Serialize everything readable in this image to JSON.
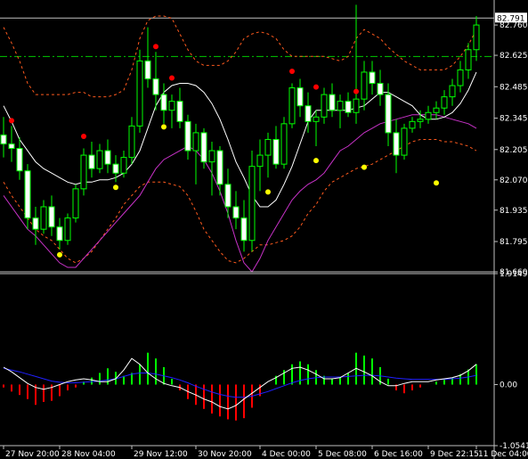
{
  "chart_data": [
    {
      "type": "candlestick",
      "panel": "price",
      "ylim": [
        81.66,
        82.8
      ],
      "y_ticks": [
        "82.760",
        "82.625",
        "82.485",
        "82.345",
        "82.205",
        "82.070",
        "81.935",
        "81.795",
        "81.660"
      ],
      "y_tick_values": [
        82.76,
        82.625,
        82.485,
        82.345,
        82.205,
        82.07,
        81.935,
        81.795,
        81.66
      ],
      "current_price_label": "82.791",
      "current_price": 82.791,
      "dashdot_level": 82.62,
      "colors": {
        "background": "#000000",
        "candle_up_body": "#000000",
        "candle_down_body": "#ffffff",
        "candle_outline": "#00ff00",
        "middle_band": "#ffffff",
        "outer_bands": "#ff5a1e",
        "slow_ma": "#c832c8",
        "dot_high": "#ff0000",
        "dot_low": "#ffff00",
        "dashdot_line": "#00c800",
        "axis": "#c0c0c0"
      },
      "candles_ohlc": [
        [
          82.27,
          82.35,
          82.17,
          82.23
        ],
        [
          82.23,
          82.31,
          82.15,
          82.21
        ],
        [
          82.21,
          82.26,
          82.07,
          82.11
        ],
        [
          82.11,
          82.14,
          81.85,
          81.9
        ],
        [
          81.9,
          81.95,
          81.78,
          81.85
        ],
        [
          81.85,
          81.98,
          81.83,
          81.95
        ],
        [
          81.95,
          82.0,
          81.82,
          81.86
        ],
        [
          81.86,
          81.9,
          81.76,
          81.8
        ],
        [
          81.8,
          81.92,
          81.78,
          81.9
        ],
        [
          81.9,
          82.05,
          81.88,
          82.03
        ],
        [
          82.03,
          82.21,
          82.0,
          82.18
        ],
        [
          82.18,
          82.24,
          82.08,
          82.12
        ],
        [
          82.12,
          82.23,
          82.1,
          82.2
        ],
        [
          82.2,
          82.25,
          82.1,
          82.14
        ],
        [
          82.14,
          82.18,
          82.06,
          82.1
        ],
        [
          82.1,
          82.2,
          82.08,
          82.17
        ],
        [
          82.17,
          82.35,
          82.14,
          82.31
        ],
        [
          82.31,
          82.65,
          82.28,
          82.6
        ],
        [
          82.6,
          82.75,
          82.48,
          82.52
        ],
        [
          82.52,
          82.64,
          82.38,
          82.45
        ],
        [
          82.45,
          82.5,
          82.32,
          82.38
        ],
        [
          82.38,
          82.45,
          82.3,
          82.42
        ],
        [
          82.42,
          82.48,
          82.3,
          82.33
        ],
        [
          82.33,
          82.36,
          82.16,
          82.2
        ],
        [
          82.2,
          82.32,
          82.05,
          82.28
        ],
        [
          82.28,
          82.3,
          82.12,
          82.15
        ],
        [
          82.15,
          82.24,
          82.0,
          82.2
        ],
        [
          82.2,
          82.22,
          82.0,
          82.05
        ],
        [
          82.05,
          82.12,
          81.9,
          81.95
        ],
        [
          81.95,
          82.02,
          81.85,
          81.9
        ],
        [
          81.9,
          81.98,
          81.75,
          81.8
        ],
        [
          81.8,
          82.2,
          81.75,
          82.13
        ],
        [
          82.13,
          82.25,
          82.02,
          82.18
        ],
        [
          82.18,
          82.28,
          82.08,
          82.25
        ],
        [
          82.25,
          82.31,
          82.12,
          82.14
        ],
        [
          82.14,
          82.35,
          82.12,
          82.32
        ],
        [
          82.32,
          82.5,
          82.3,
          82.48
        ],
        [
          82.48,
          82.52,
          82.35,
          82.4
        ],
        [
          82.4,
          82.46,
          82.28,
          82.33
        ],
        [
          82.33,
          82.38,
          82.22,
          82.35
        ],
        [
          82.35,
          82.48,
          82.32,
          82.45
        ],
        [
          82.45,
          82.5,
          82.35,
          82.38
        ],
        [
          82.38,
          82.45,
          82.3,
          82.42
        ],
        [
          82.42,
          82.46,
          82.35,
          82.37
        ],
        [
          82.37,
          82.85,
          82.32,
          82.43
        ],
        [
          82.43,
          82.6,
          82.38,
          82.55
        ],
        [
          82.55,
          82.6,
          82.45,
          82.5
        ],
        [
          82.5,
          82.56,
          82.4,
          82.45
        ],
        [
          82.45,
          82.5,
          82.22,
          82.28
        ],
        [
          82.28,
          82.34,
          82.1,
          82.18
        ],
        [
          82.18,
          82.32,
          82.16,
          82.3
        ],
        [
          82.3,
          82.35,
          82.28,
          82.33
        ],
        [
          82.33,
          82.38,
          82.3,
          82.34
        ],
        [
          82.34,
          82.4,
          82.32,
          82.37
        ],
        [
          82.37,
          82.42,
          82.34,
          82.39
        ],
        [
          82.39,
          82.47,
          82.36,
          82.44
        ],
        [
          82.44,
          82.52,
          82.4,
          82.49
        ],
        [
          82.49,
          82.6,
          82.46,
          82.56
        ],
        [
          82.56,
          82.68,
          82.52,
          82.65
        ],
        [
          82.65,
          82.8,
          82.6,
          82.76
        ]
      ],
      "high_dots": [
        [
          1,
          82.31
        ],
        [
          10,
          82.24
        ],
        [
          19,
          82.64
        ],
        [
          21,
          82.5
        ],
        [
          36,
          82.53
        ],
        [
          39,
          82.46
        ],
        [
          44,
          82.44
        ]
      ],
      "low_dots": [
        [
          7,
          81.76
        ],
        [
          14,
          82.06
        ],
        [
          20,
          82.33
        ],
        [
          33,
          82.04
        ],
        [
          39,
          82.18
        ],
        [
          45,
          82.15
        ],
        [
          54,
          82.08
        ]
      ],
      "middle_band": [
        82.4,
        82.33,
        82.25,
        82.2,
        82.15,
        82.12,
        82.1,
        82.08,
        82.06,
        82.05,
        82.06,
        82.06,
        82.07,
        82.07,
        82.08,
        82.1,
        82.14,
        82.2,
        82.3,
        82.4,
        82.46,
        82.49,
        82.5,
        82.5,
        82.49,
        82.46,
        82.41,
        82.34,
        82.25,
        82.15,
        82.08,
        82.0,
        81.95,
        81.95,
        81.98,
        82.05,
        82.13,
        82.23,
        82.33,
        82.38,
        82.38,
        82.38,
        82.38,
        82.38,
        82.39,
        82.4,
        82.43,
        82.46,
        82.46,
        82.44,
        82.42,
        82.4,
        82.36,
        82.34,
        82.34,
        82.35,
        82.37,
        82.41,
        82.47,
        82.55
      ],
      "upper_band": [
        82.75,
        82.68,
        82.6,
        82.5,
        82.45,
        82.45,
        82.45,
        82.45,
        82.45,
        82.46,
        82.46,
        82.44,
        82.44,
        82.44,
        82.45,
        82.47,
        82.56,
        82.7,
        82.78,
        82.8,
        82.8,
        82.79,
        82.72,
        82.65,
        82.6,
        82.58,
        82.58,
        82.58,
        82.6,
        82.64,
        82.7,
        82.72,
        82.73,
        82.72,
        82.7,
        82.65,
        82.62,
        82.62,
        82.62,
        82.62,
        82.62,
        82.61,
        82.6,
        82.62,
        82.7,
        82.74,
        82.72,
        82.7,
        82.66,
        82.63,
        82.6,
        82.58,
        82.56,
        82.56,
        82.56,
        82.56,
        82.58,
        82.62,
        82.67,
        82.74
      ],
      "lower_band": [
        82.06,
        82.0,
        81.95,
        81.9,
        81.85,
        81.82,
        81.8,
        81.76,
        81.72,
        81.7,
        81.72,
        81.75,
        81.8,
        81.85,
        81.9,
        81.96,
        82.0,
        82.04,
        82.06,
        82.06,
        82.06,
        82.05,
        82.04,
        82.0,
        81.93,
        81.85,
        81.8,
        81.75,
        81.71,
        81.7,
        81.72,
        81.75,
        81.78,
        81.78,
        81.79,
        81.8,
        81.82,
        81.86,
        81.92,
        81.96,
        82.02,
        82.06,
        82.08,
        82.1,
        82.12,
        82.13,
        82.14,
        82.16,
        82.18,
        82.2,
        82.22,
        82.24,
        82.25,
        82.25,
        82.25,
        82.24,
        82.24,
        82.23,
        82.22,
        82.2
      ],
      "slow_ma": [
        82.0,
        81.95,
        81.9,
        81.85,
        81.82,
        81.78,
        81.74,
        81.7,
        81.68,
        81.68,
        81.72,
        81.76,
        81.8,
        81.84,
        81.88,
        81.92,
        81.96,
        82.0,
        82.06,
        82.12,
        82.16,
        82.18,
        82.2,
        82.22,
        82.2,
        82.16,
        82.1,
        82.02,
        81.92,
        81.8,
        81.7,
        81.66,
        81.72,
        81.8,
        81.86,
        81.92,
        81.98,
        82.02,
        82.05,
        82.07,
        82.1,
        82.15,
        82.2,
        82.22,
        82.25,
        82.28,
        82.3,
        82.32,
        82.33,
        82.34,
        82.35,
        82.36,
        82.36,
        82.36,
        82.36,
        82.35,
        82.34,
        82.33,
        82.32,
        82.3
      ]
    },
    {
      "type": "histogram",
      "panel": "oscillator",
      "ylim": [
        -1.0541,
        1.9149
      ],
      "y_ticks": [
        "1.9149",
        "0.00",
        "-1.0541"
      ],
      "y_tick_values": [
        1.9149,
        0.0,
        -1.0541
      ],
      "x_ticks": [
        "27 Nov 20:00",
        "28 Nov 04:00",
        "29 Nov 12:00",
        "30 Nov 20:00",
        "4 Dec 00:00",
        "5 Dec 08:00",
        "6 Dec 16:00",
        "9 Dec 22:15",
        "11 Dec 04:00"
      ],
      "x_tick_index": [
        0,
        7,
        16,
        24,
        32,
        39,
        46,
        53,
        59
      ],
      "colors": {
        "positive_bar": "#00ff00",
        "negative_bar": "#ff0000",
        "line_white": "#ffffff",
        "line_blue": "#2020ff"
      },
      "bars": [
        -0.05,
        -0.12,
        -0.18,
        -0.25,
        -0.35,
        -0.3,
        -0.28,
        -0.2,
        -0.1,
        -0.05,
        0.05,
        0.12,
        0.2,
        0.28,
        0.22,
        0.15,
        0.2,
        0.35,
        0.55,
        0.45,
        0.3,
        0.1,
        -0.1,
        -0.25,
        -0.35,
        -0.42,
        -0.5,
        -0.55,
        -0.6,
        -0.62,
        -0.58,
        -0.4,
        -0.2,
        0.0,
        0.15,
        0.25,
        0.35,
        0.4,
        0.35,
        0.25,
        0.15,
        0.1,
        0.12,
        0.2,
        0.55,
        0.5,
        0.45,
        0.3,
        0.1,
        -0.1,
        -0.15,
        -0.1,
        -0.05,
        0.0,
        0.05,
        0.08,
        0.12,
        0.18,
        0.26,
        0.35
      ],
      "white_line": [
        0.3,
        0.22,
        0.12,
        0.02,
        -0.05,
        -0.08,
        -0.05,
        0.0,
        0.05,
        0.08,
        0.1,
        0.08,
        0.05,
        0.05,
        0.1,
        0.25,
        0.45,
        0.35,
        0.2,
        0.1,
        0.02,
        -0.02,
        -0.05,
        -0.12,
        -0.18,
        -0.25,
        -0.3,
        -0.38,
        -0.42,
        -0.36,
        -0.25,
        -0.15,
        -0.05,
        0.05,
        0.12,
        0.2,
        0.28,
        0.3,
        0.25,
        0.18,
        0.1,
        0.1,
        0.12,
        0.2,
        0.28,
        0.22,
        0.15,
        0.05,
        -0.02,
        -0.02,
        0.02,
        0.05,
        0.05,
        0.05,
        0.08,
        0.1,
        0.12,
        0.16,
        0.24,
        0.35
      ],
      "blue_line": [
        0.28,
        0.25,
        0.22,
        0.18,
        0.14,
        0.1,
        0.06,
        0.04,
        0.03,
        0.03,
        0.04,
        0.05,
        0.06,
        0.08,
        0.1,
        0.14,
        0.18,
        0.2,
        0.2,
        0.18,
        0.15,
        0.12,
        0.08,
        0.03,
        -0.03,
        -0.08,
        -0.13,
        -0.17,
        -0.2,
        -0.22,
        -0.22,
        -0.2,
        -0.16,
        -0.12,
        -0.07,
        -0.02,
        0.03,
        0.07,
        0.1,
        0.12,
        0.13,
        0.13,
        0.13,
        0.14,
        0.15,
        0.16,
        0.16,
        0.15,
        0.13,
        0.11,
        0.1,
        0.09,
        0.09,
        0.09,
        0.09,
        0.09,
        0.1,
        0.11,
        0.13,
        0.16
      ]
    }
  ]
}
